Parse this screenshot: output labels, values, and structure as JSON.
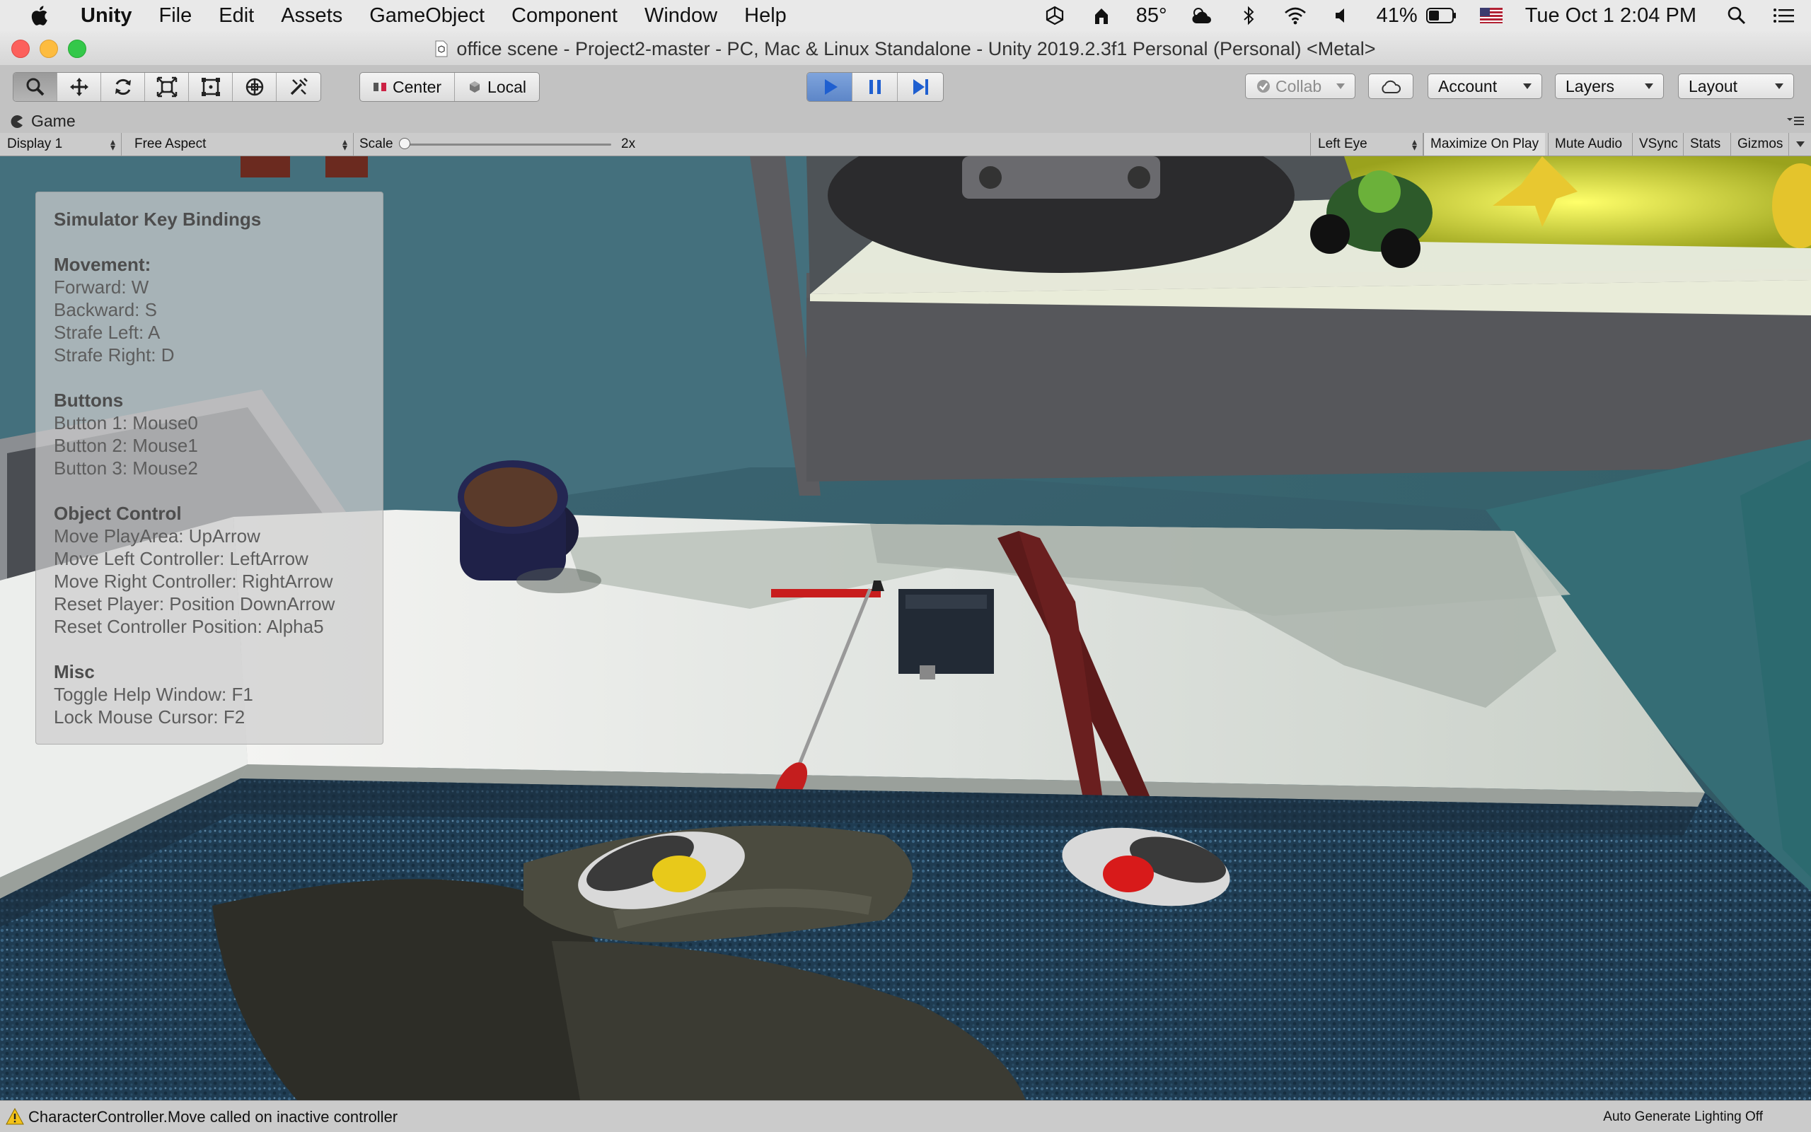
{
  "menubar": {
    "items": [
      "Unity",
      "File",
      "Edit",
      "Assets",
      "GameObject",
      "Component",
      "Window",
      "Help"
    ],
    "temperature": "85°",
    "battery": "41%",
    "datetime": "Tue Oct 1  2:04 PM"
  },
  "window": {
    "title": "office scene - Project2-master - PC, Mac & Linux Standalone - Unity 2019.2.3f1 Personal (Personal) <Metal>"
  },
  "toolbar": {
    "tools": [
      "hand-tool-icon",
      "move-tool-icon",
      "rotate-tool-icon",
      "scale-tool-icon",
      "rect-tool-icon",
      "transform-tool-icon",
      "custom-tool-icon"
    ],
    "pivot_center": "Center",
    "pivot_local": "Local",
    "collab": "Collab",
    "account": "Account",
    "layers": "Layers",
    "layout": "Layout"
  },
  "tab": {
    "label": "Game"
  },
  "gamebar": {
    "display": "Display 1",
    "aspect": "Free Aspect",
    "scale_label": "Scale",
    "scale_value": "2x",
    "scale_level": 0.0,
    "eye": "Left Eye",
    "maximize": "Maximize On Play",
    "mute": "Mute Audio",
    "vsync": "VSync",
    "stats": "Stats",
    "gizmos": "Gizmos"
  },
  "help": {
    "title": "Simulator Key Bindings",
    "movement": {
      "heading": "Movement:",
      "lines": [
        "Forward: W",
        "Backward: S",
        "Strafe Left: A",
        "Strafe Right: D"
      ]
    },
    "buttons": {
      "heading": "Buttons",
      "lines": [
        "Button 1: Mouse0",
        "Button 2: Mouse1",
        "Button 3: Mouse2"
      ]
    },
    "object_control": {
      "heading": "Object Control",
      "lines": [
        "Move PlayArea: UpArrow",
        "Move Left Controller: LeftArrow",
        "Move Right Controller: RightArrow",
        "Reset Player: Position DownArrow",
        "Reset Controller Position: Alpha5"
      ]
    },
    "misc": {
      "heading": "Misc",
      "lines": [
        "Toggle Help Window: F1",
        "Lock Mouse Cursor: F2"
      ]
    }
  },
  "status": {
    "message": "CharacterController.Move called on inactive controller",
    "lighting": "Auto Generate Lighting Off"
  },
  "colors": {
    "play_blue": "#3d6fd1",
    "editor_gray": "#c2c2c2",
    "wall_teal": "#3d6772"
  }
}
